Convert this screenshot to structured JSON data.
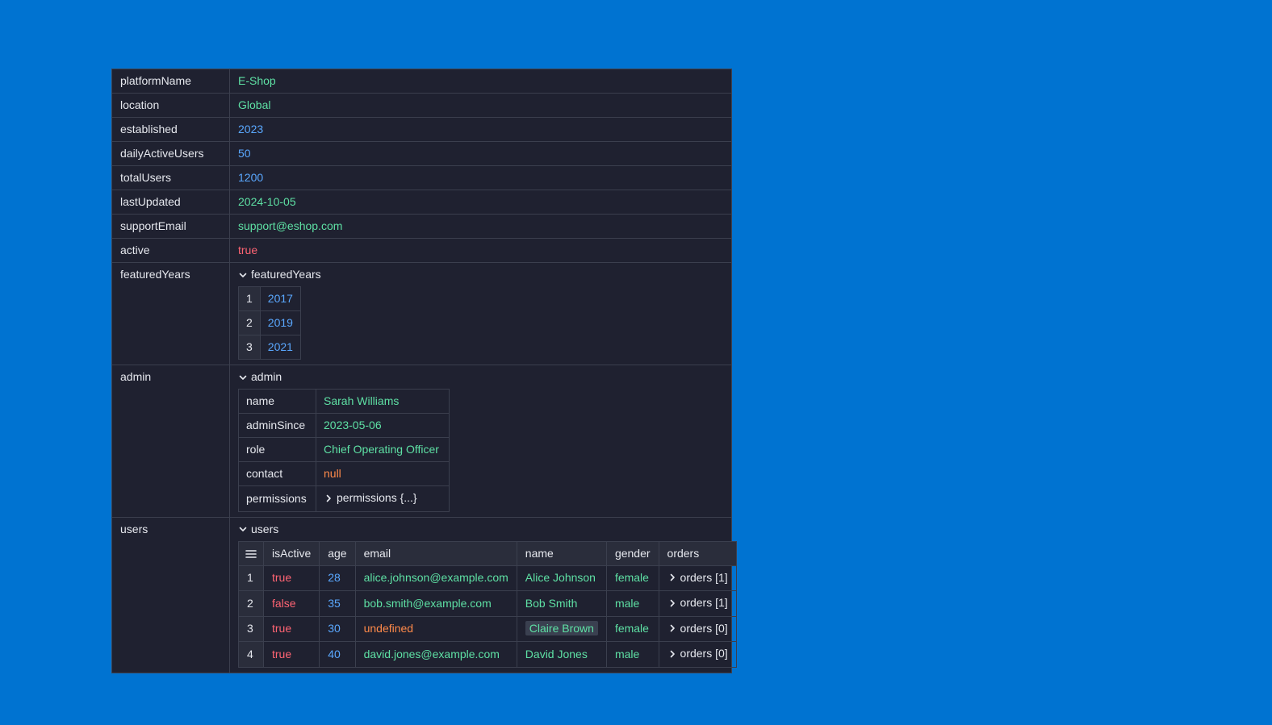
{
  "rows": {
    "platformName": {
      "key": "platformName",
      "value": "E-Shop"
    },
    "location": {
      "key": "location",
      "value": "Global"
    },
    "established": {
      "key": "established",
      "value": "2023"
    },
    "dailyActiveUsers": {
      "key": "dailyActiveUsers",
      "value": "50"
    },
    "totalUsers": {
      "key": "totalUsers",
      "value": "1200"
    },
    "lastUpdated": {
      "key": "lastUpdated",
      "value": "2024-10-05"
    },
    "supportEmail": {
      "key": "supportEmail",
      "value": "support@eshop.com"
    },
    "active": {
      "key": "active",
      "value": "true"
    }
  },
  "featuredYears": {
    "key": "featuredYears",
    "toggle_label": "featuredYears",
    "items": [
      {
        "index": "1",
        "value": "2017"
      },
      {
        "index": "2",
        "value": "2019"
      },
      {
        "index": "3",
        "value": "2021"
      }
    ]
  },
  "admin": {
    "key": "admin",
    "toggle_label": "admin",
    "fields": {
      "name": {
        "key": "name",
        "value": "Sarah Williams"
      },
      "adminSince": {
        "key": "adminSince",
        "value": "2023-05-06"
      },
      "role": {
        "key": "role",
        "value": "Chief Operating Officer"
      },
      "contact": {
        "key": "contact",
        "value": "null"
      },
      "permissions": {
        "key": "permissions",
        "value": "permissions {...}"
      }
    }
  },
  "users": {
    "key": "users",
    "toggle_label": "users",
    "columns": [
      "isActive",
      "age",
      "email",
      "name",
      "gender",
      "orders"
    ],
    "rows": [
      {
        "index": "1",
        "isActive": "true",
        "age": "28",
        "email": "alice.johnson@example.com",
        "name": "Alice Johnson",
        "gender": "female",
        "orders": "orders [1]"
      },
      {
        "index": "2",
        "isActive": "false",
        "age": "35",
        "email": "bob.smith@example.com",
        "name": "Bob Smith",
        "gender": "male",
        "orders": "orders [1]"
      },
      {
        "index": "3",
        "isActive": "true",
        "age": "30",
        "email": "undefined",
        "name": "Claire Brown",
        "gender": "female",
        "orders": "orders [0]"
      },
      {
        "index": "4",
        "isActive": "true",
        "age": "40",
        "email": "david.jones@example.com",
        "name": "David Jones",
        "gender": "male",
        "orders": "orders [0]"
      }
    ]
  },
  "colors": {
    "background": "#0073d1",
    "panel": "#1f2130",
    "string": "#5ee0a4",
    "number": "#5aa8ff",
    "boolean": "#ff6473",
    "null": "#ff8a4a"
  },
  "icons": {
    "expanded": "chevron-down-icon",
    "collapsed": "chevron-right-icon",
    "table_menu": "menu-icon"
  }
}
